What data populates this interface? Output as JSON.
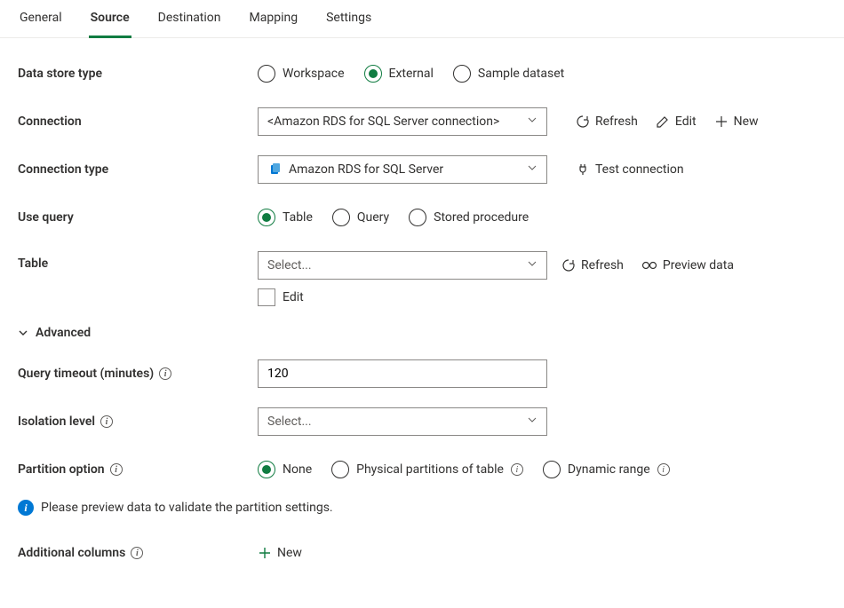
{
  "tabs": {
    "general": "General",
    "source": "Source",
    "destination": "Destination",
    "mapping": "Mapping",
    "settings": "Settings",
    "active": "source"
  },
  "labels": {
    "data_store_type": "Data store type",
    "connection": "Connection",
    "connection_type": "Connection type",
    "use_query": "Use query",
    "table": "Table",
    "advanced": "Advanced",
    "query_timeout": "Query timeout (minutes)",
    "isolation_level": "Isolation level",
    "partition_option": "Partition option",
    "additional_columns": "Additional columns"
  },
  "data_store_type": {
    "options": {
      "workspace": "Workspace",
      "external": "External",
      "sample": "Sample dataset"
    },
    "selected": "external"
  },
  "connection": {
    "value": "<Amazon RDS for SQL Server connection>",
    "actions": {
      "refresh": "Refresh",
      "edit": "Edit",
      "new": "New"
    }
  },
  "connection_type": {
    "value": "Amazon RDS for SQL Server",
    "action": "Test connection"
  },
  "use_query": {
    "options": {
      "table": "Table",
      "query": "Query",
      "stored": "Stored procedure"
    },
    "selected": "table"
  },
  "table": {
    "placeholder": "Select...",
    "value": "",
    "edit_label": "Edit",
    "edit_checked": false,
    "actions": {
      "refresh": "Refresh",
      "preview": "Preview data"
    }
  },
  "query_timeout": {
    "value": "120"
  },
  "isolation_level": {
    "placeholder": "Select...",
    "value": ""
  },
  "partition_option": {
    "options": {
      "none": "None",
      "physical": "Physical partitions of table",
      "dynamic": "Dynamic range"
    },
    "selected": "none"
  },
  "info_message": "Please preview data to validate the partition settings.",
  "additional_columns": {
    "new_label": "New"
  }
}
